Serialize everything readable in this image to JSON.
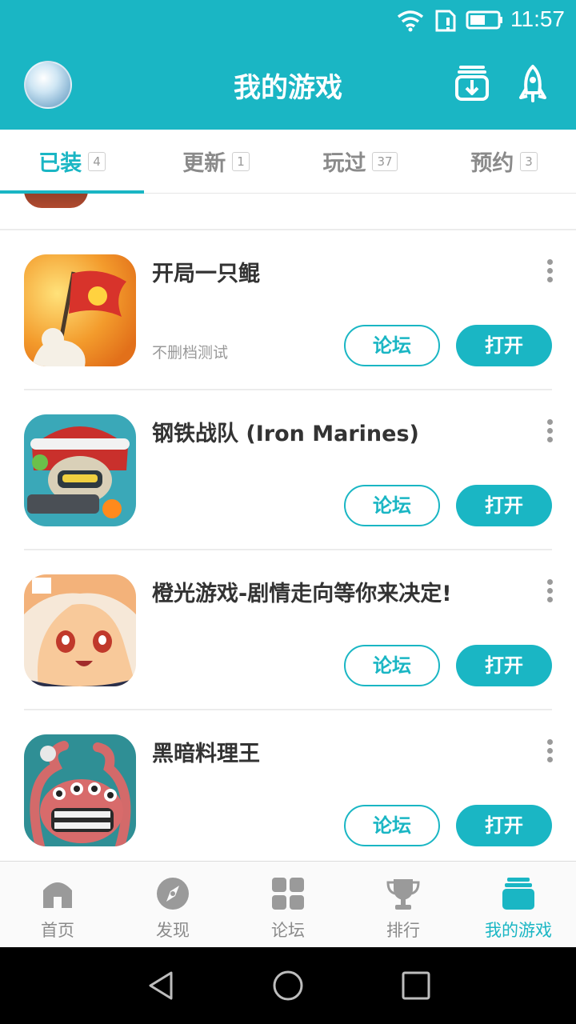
{
  "status_bar": {
    "time": "11:57",
    "icons": [
      "wifi-icon",
      "sim-icon",
      "battery-icon"
    ]
  },
  "header": {
    "title": "我的游戏",
    "icons": [
      "avatar",
      "download-manager-icon",
      "rocket-icon"
    ],
    "color": "#1ab6c4"
  },
  "tabs": [
    {
      "label": "已装",
      "count": "4",
      "active": true
    },
    {
      "label": "更新",
      "count": "1",
      "active": false
    },
    {
      "label": "玩过",
      "count": "37",
      "active": false
    },
    {
      "label": "预约",
      "count": "3",
      "active": false
    }
  ],
  "games": [
    {
      "name": "开局一只鲲",
      "subtitle": "不删档测试",
      "forum_label": "论坛",
      "open_label": "打开"
    },
    {
      "name": "钢铁战队 (Iron Marines)",
      "subtitle": "",
      "forum_label": "论坛",
      "open_label": "打开"
    },
    {
      "name": "橙光游戏-剧情走向等你来决定!",
      "subtitle": "",
      "forum_label": "论坛",
      "open_label": "打开"
    },
    {
      "name": "黑暗料理王",
      "subtitle": "",
      "forum_label": "论坛",
      "open_label": "打开"
    }
  ],
  "bottom_nav": [
    {
      "label": "首页",
      "icon": "home-icon",
      "active": false
    },
    {
      "label": "发现",
      "icon": "compass-icon",
      "active": false
    },
    {
      "label": "论坛",
      "icon": "grid-icon",
      "active": false
    },
    {
      "label": "排行",
      "icon": "trophy-icon",
      "active": false
    },
    {
      "label": "我的游戏",
      "icon": "stack-icon",
      "active": true
    }
  ],
  "system_nav": [
    "back-icon",
    "home-circle-icon",
    "recents-icon"
  ]
}
